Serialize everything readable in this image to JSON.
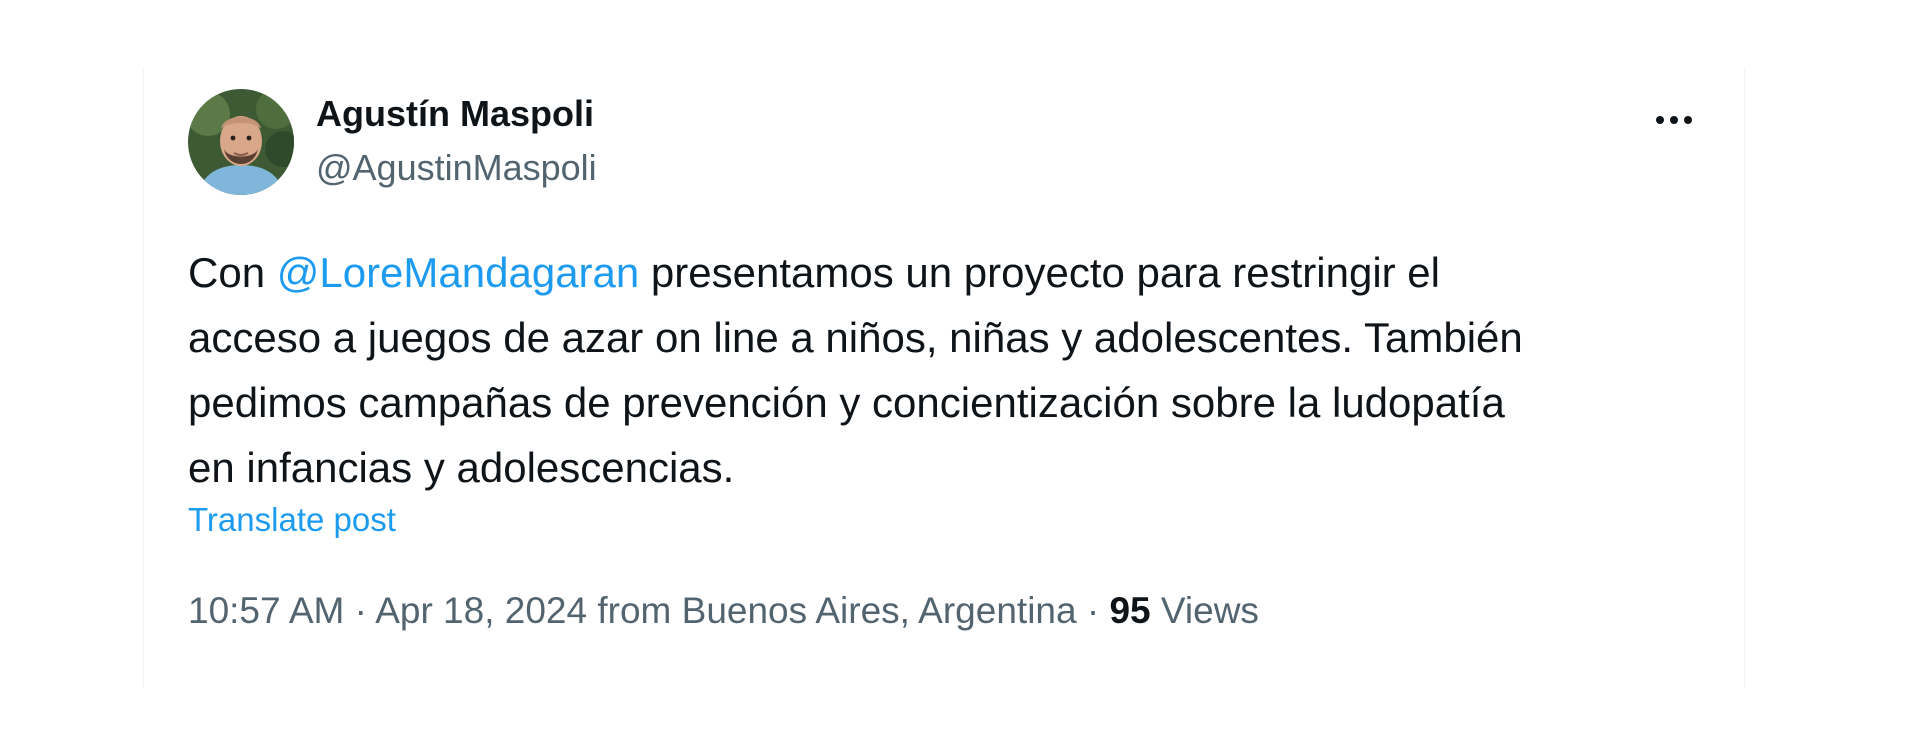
{
  "author": {
    "display_name": "Agustín Maspoli",
    "handle": "@AgustinMaspoli",
    "avatar_icon": "user-photo"
  },
  "more_icon": "more-horizontal-icon",
  "post": {
    "text_before_mention": "Con ",
    "mention": "@LoreMandagaran",
    "text_after_line1": " presentamos un proyecto para restringir el",
    "line2": "acceso a juegos de azar on line a niños, niñas y adolescentes. También",
    "line3": "pedimos campañas de prevención y concientización sobre la ludopatía",
    "line4": "en infancias y adolescencias."
  },
  "translate_label": "Translate post",
  "meta": {
    "time": "10:57 AM",
    "separator": " · ",
    "date": "Apr 18, 2024",
    "location": " from Buenos Aires, Argentina",
    "separator2": " · ",
    "views_count": "95",
    "views_label": " Views"
  },
  "colors": {
    "accent": "#1d9bf0",
    "text_primary": "#0f1419",
    "text_secondary": "#536471"
  }
}
